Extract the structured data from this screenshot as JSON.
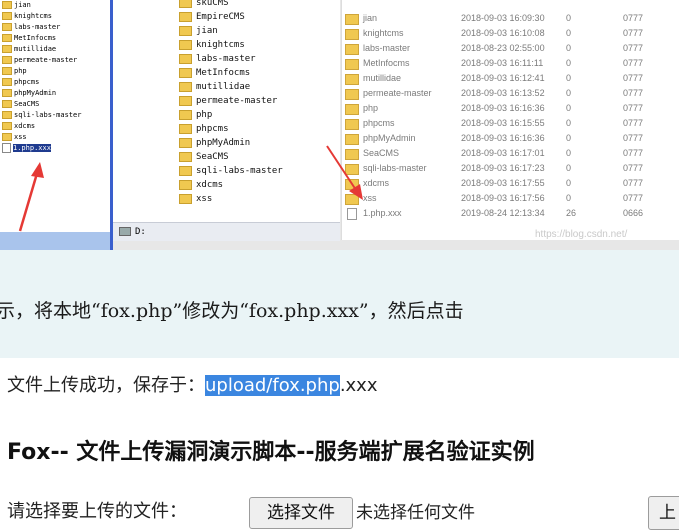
{
  "tree": {
    "items": [
      "jian",
      "knightcms",
      "labs-master",
      "MetInfocms",
      "mutillidae",
      "permeate-master",
      "php",
      "phpcms",
      "phpMyAdmin",
      "SeaCMS",
      "sqli-labs-master",
      "xdcms",
      "xss",
      "1.php.xxx"
    ]
  },
  "middle": {
    "items": [
      "skuCMS",
      "EmpireCMS",
      "jian",
      "knightcms",
      "labs-master",
      "MetInfocms",
      "mutillidae",
      "permeate-master",
      "php",
      "phpcms",
      "phpMyAdmin",
      "SeaCMS",
      "sqli-labs-master",
      "xdcms",
      "xss"
    ],
    "drive": "D:"
  },
  "files": {
    "rows": [
      {
        "name": "jian",
        "date": "2018-09-03 16:09:30",
        "size": "0",
        "perm": "0777",
        "type": "folder"
      },
      {
        "name": "knightcms",
        "date": "2018-09-03 16:10:08",
        "size": "0",
        "perm": "0777",
        "type": "folder"
      },
      {
        "name": "labs-master",
        "date": "2018-08-23 02:55:00",
        "size": "0",
        "perm": "0777",
        "type": "folder"
      },
      {
        "name": "MetInfocms",
        "date": "2018-09-03 16:11:11",
        "size": "0",
        "perm": "0777",
        "type": "folder"
      },
      {
        "name": "mutillidae",
        "date": "2018-09-03 16:12:41",
        "size": "0",
        "perm": "0777",
        "type": "folder"
      },
      {
        "name": "permeate-master",
        "date": "2018-09-03 16:13:52",
        "size": "0",
        "perm": "0777",
        "type": "folder"
      },
      {
        "name": "php",
        "date": "2018-09-03 16:16:36",
        "size": "0",
        "perm": "0777",
        "type": "folder"
      },
      {
        "name": "phpcms",
        "date": "2018-09-03 16:15:55",
        "size": "0",
        "perm": "0777",
        "type": "folder"
      },
      {
        "name": "phpMyAdmin",
        "date": "2018-09-03 16:16:36",
        "size": "0",
        "perm": "0777",
        "type": "folder"
      },
      {
        "name": "SeaCMS",
        "date": "2018-09-03 16:17:01",
        "size": "0",
        "perm": "0777",
        "type": "folder"
      },
      {
        "name": "sqli-labs-master",
        "date": "2018-09-03 16:17:23",
        "size": "0",
        "perm": "0777",
        "type": "folder"
      },
      {
        "name": "xdcms",
        "date": "2018-09-03 16:17:55",
        "size": "0",
        "perm": "0777",
        "type": "folder"
      },
      {
        "name": "xss",
        "date": "2018-09-03 16:17:56",
        "size": "0",
        "perm": "0777",
        "type": "folder"
      },
      {
        "name": "1.php.xxx",
        "date": "2019-08-24 12:13:34",
        "size": "26",
        "perm": "0666",
        "type": "file"
      }
    ]
  },
  "watermark": "https://blog.csdn.net/",
  "caption": "示，将本地“fox.php”修改为“fox.php.xxx”，然后点击",
  "page": {
    "success_prefix": "文件上传成功，保存于：",
    "success_path": "upload/fox.php",
    "success_suffix": ".xxx",
    "heading": "Fox-- 文件上传漏洞演示脚本--服务端扩展名验证实例",
    "choose_label": "请选择要上传的文件：",
    "choose_button": "选择文件",
    "no_file": "未选择任何文件",
    "upload_button": "上"
  },
  "colors": {
    "highlight": "#3b86e0",
    "selection": "#1f3b8f",
    "arrow": "#e53935",
    "caption_bg": "#eaf4f6"
  }
}
